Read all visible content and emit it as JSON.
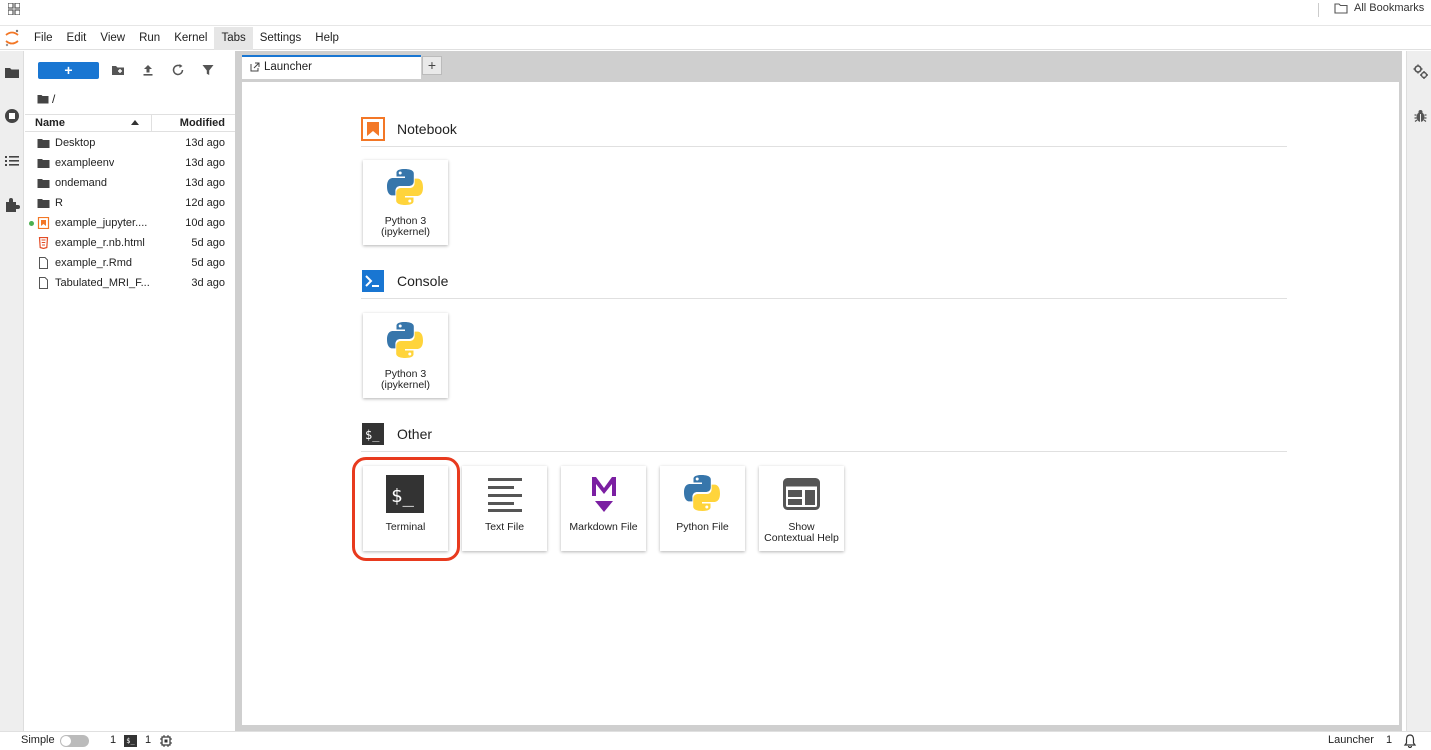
{
  "browser": {
    "bookmarks_label": "All Bookmarks"
  },
  "menubar": {
    "items": [
      "File",
      "Edit",
      "View",
      "Run",
      "Kernel",
      "Tabs",
      "Settings",
      "Help"
    ],
    "active": "Tabs"
  },
  "filebrowser": {
    "new_label": "+",
    "breadcrumb": "/",
    "col_name": "Name",
    "col_modified": "Modified",
    "files": [
      {
        "name": "Desktop",
        "modified": "13d ago",
        "type": "folder"
      },
      {
        "name": "exampleenv",
        "modified": "13d ago",
        "type": "folder"
      },
      {
        "name": "ondemand",
        "modified": "13d ago",
        "type": "folder"
      },
      {
        "name": "R",
        "modified": "12d ago",
        "type": "folder"
      },
      {
        "name": "example_jupyter....",
        "modified": "10d ago",
        "type": "notebook",
        "running": true
      },
      {
        "name": "example_r.nb.html",
        "modified": "5d ago",
        "type": "html"
      },
      {
        "name": "example_r.Rmd",
        "modified": "5d ago",
        "type": "file"
      },
      {
        "name": "Tabulated_MRI_F...",
        "modified": "3d ago",
        "type": "file"
      }
    ]
  },
  "tabs": {
    "active_label": "Launcher",
    "add_label": "+"
  },
  "launcher": {
    "sections": [
      {
        "title": "Notebook",
        "cards": [
          {
            "label_line1": "Python 3",
            "label_line2": "(ipykernel)"
          }
        ]
      },
      {
        "title": "Console",
        "cards": [
          {
            "label_line1": "Python 3",
            "label_line2": "(ipykernel)"
          }
        ]
      },
      {
        "title": "Other",
        "cards": [
          {
            "label_line1": "Terminal",
            "label_line2": ""
          },
          {
            "label_line1": "Text File",
            "label_line2": ""
          },
          {
            "label_line1": "Markdown File",
            "label_line2": ""
          },
          {
            "label_line1": "Python File",
            "label_line2": ""
          },
          {
            "label_line1": "Show",
            "label_line2": "Contextual Help"
          }
        ]
      }
    ]
  },
  "statusbar": {
    "mode_label": "Simple",
    "terminals_count": "1",
    "kernels_count": "1",
    "terminal_badge": "$_",
    "right_label": "Launcher",
    "right_count": "1"
  },
  "colors": {
    "accent": "#1976d2",
    "notebook_orange": "#f37726",
    "console_blue": "#1976d2",
    "markdown_purple": "#7b1fa2",
    "highlight_red": "#e83a1e"
  }
}
